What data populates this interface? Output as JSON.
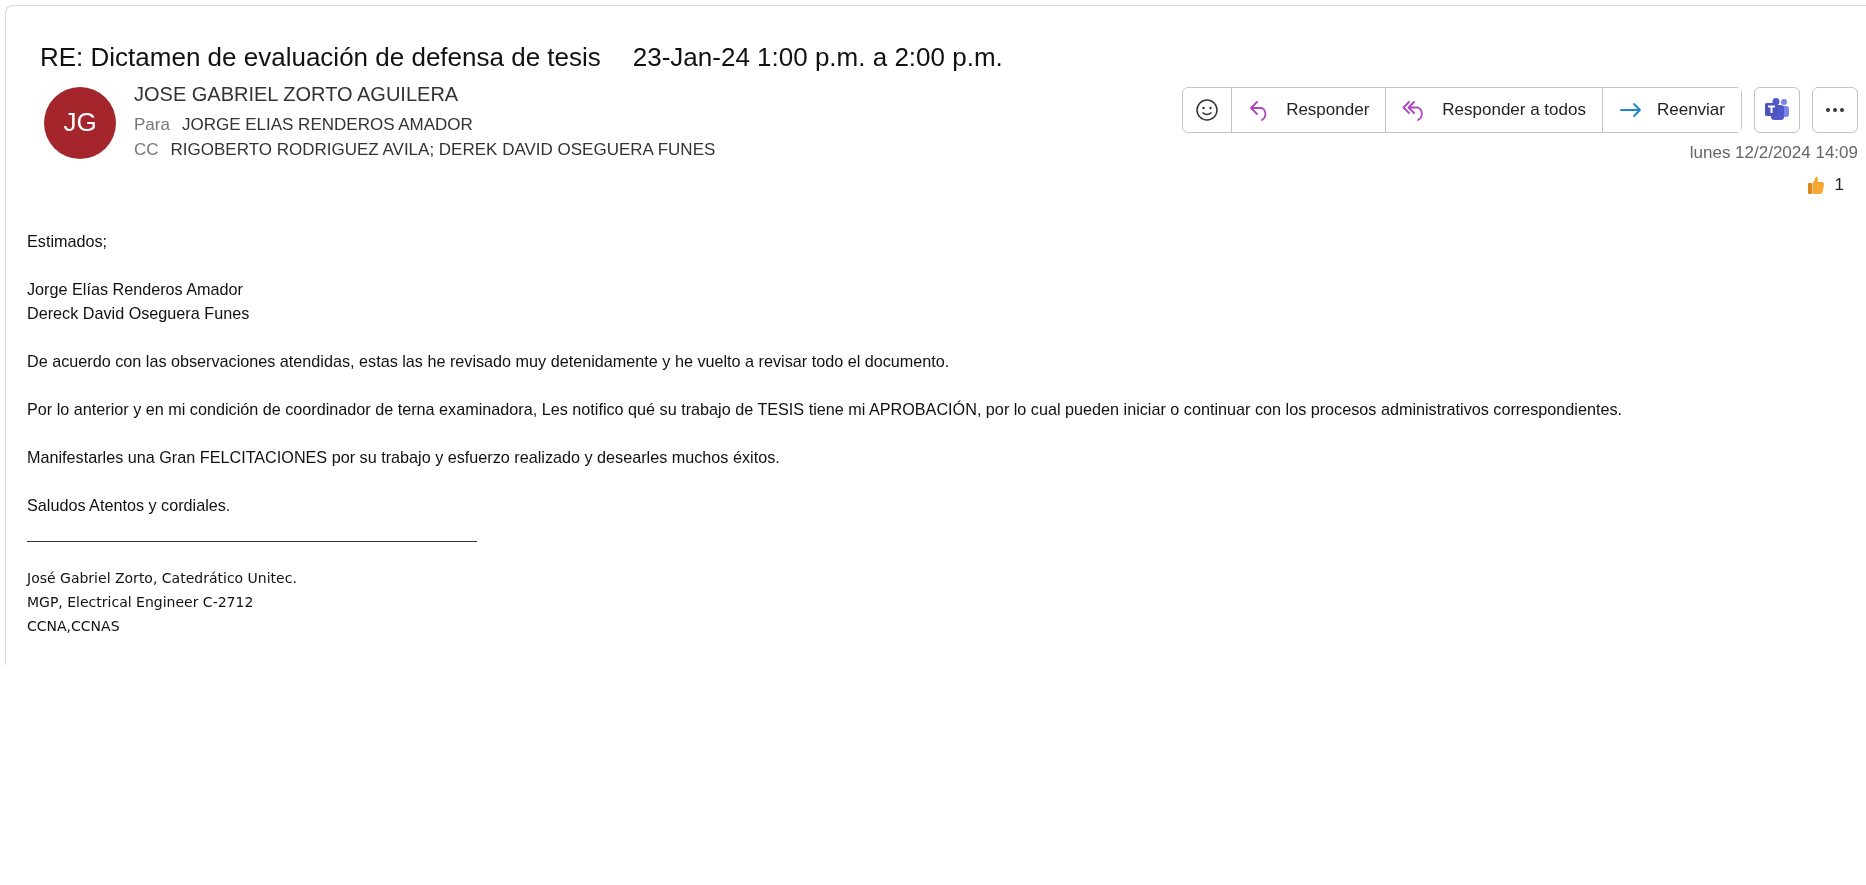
{
  "subject": {
    "title": "RE: Dictamen de evaluación de defensa de tesis",
    "event": "23-Jan-24 1:00 p.m. a 2:00 p.m."
  },
  "sender": {
    "initials": "JG",
    "name": "JOSE GABRIEL ZORTO AGUILERA",
    "color": "#a4262c"
  },
  "recipients": [
    {
      "label": "Para",
      "value": "JORGE ELIAS RENDEROS AMADOR"
    },
    {
      "label": "CC",
      "value": "RIGOBERTO RODRIGUEZ AVILA; DEREK DAVID OSEGUERA FUNES"
    }
  ],
  "actions": [
    {
      "kind": "reply",
      "label": "Responder"
    },
    {
      "kind": "reply_all",
      "label": "Responder a todos"
    },
    {
      "kind": "forward",
      "label": "Reenviar"
    }
  ],
  "date": "lunes 12/2/2024 14:09",
  "reaction": {
    "count": "1"
  },
  "body": [
    [
      "Estimados;"
    ],
    [
      "Jorge Elías Renderos Amador",
      "Dereck David Oseguera Funes"
    ],
    [
      "De acuerdo con las observaciones atendidas, estas las he revisado muy detenidamente y he vuelto a revisar todo el documento."
    ],
    [
      "Por lo anterior y en mi condición de coordinador de terna examinadora, Les notifico qué su trabajo de TESIS tiene mi  APROBACIÓN, por lo cual pueden iniciar o continuar con los procesos administrativos correspondientes."
    ],
    [
      "Manifestarles una Gran FELCITACIONES por su trabajo y esfuerzo realizado y desearles muchos éxitos."
    ],
    [
      "Saludos Atentos y cordiales."
    ]
  ],
  "signature": [
    "José Gabriel Zorto, Catedrático Unitec.",
    "MGP, Electrical Engineer C-2712",
    "CCNA,CCNAS"
  ]
}
